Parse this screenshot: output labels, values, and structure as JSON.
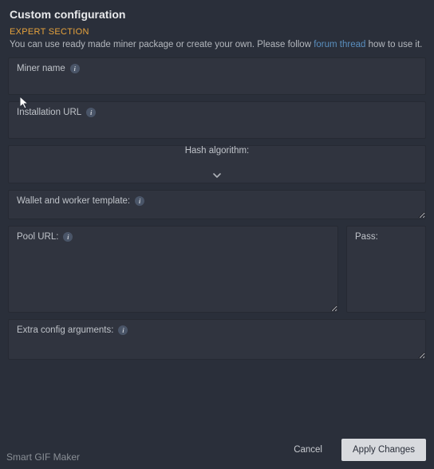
{
  "header": {
    "title": "Custom configuration"
  },
  "expert": {
    "label": "EXPERT SECTION",
    "desc_before": "You can use ready made miner package or create your own. Please follow ",
    "link_text": "forum thread",
    "desc_after": " how to use it."
  },
  "fields": {
    "miner_name": {
      "label": "Miner name",
      "value": ""
    },
    "install_url": {
      "label": "Installation URL",
      "value": ""
    },
    "hash_algo": {
      "label": "Hash algorithm:",
      "value": ""
    },
    "wallet": {
      "label": "Wallet and worker template:",
      "value": ""
    },
    "pool_url": {
      "label": "Pool URL:",
      "value": ""
    },
    "pass": {
      "label": "Pass:",
      "value": ""
    },
    "extra": {
      "label": "Extra config arguments:",
      "value": ""
    }
  },
  "footer": {
    "cancel": "Cancel",
    "apply": "Apply Changes"
  },
  "watermark": "Smart GIF Maker"
}
